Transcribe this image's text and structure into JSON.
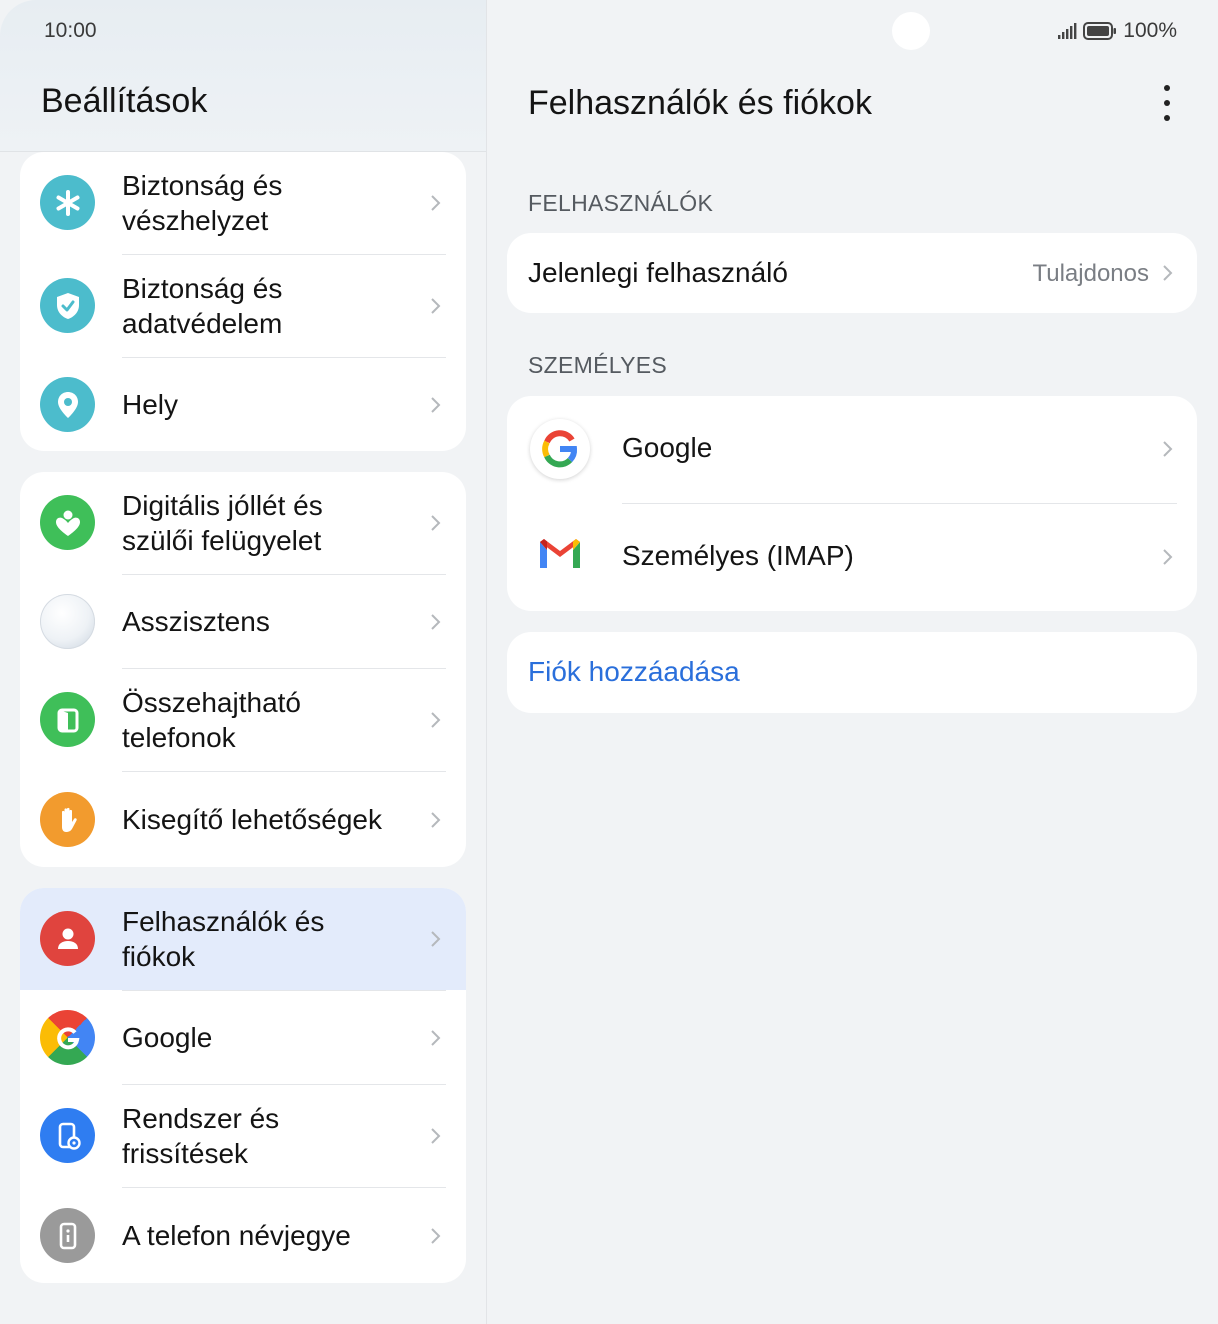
{
  "status_bar": {
    "time": "10:00",
    "battery": "100%"
  },
  "left": {
    "title": "Beállítások",
    "groups": [
      {
        "items": [
          {
            "label_line1": "Biztonság és",
            "label_line2": "vészhelyzet",
            "icon": "emergency-asterisk-icon",
            "color": "#4cbccc"
          },
          {
            "label_line1": "Biztonság és",
            "label_line2": "adatvédelem",
            "icon": "shield-check-icon",
            "color": "#4cbccc"
          },
          {
            "label_line1": "Hely",
            "icon": "location-pin-icon",
            "color": "#4cbccc"
          }
        ]
      },
      {
        "items": [
          {
            "label_line1": "Digitális jóllét és",
            "label_line2": "szülői felügyelet",
            "icon": "heart-person-icon",
            "color": "#3fbf59"
          },
          {
            "label_line1": "Asszisztens",
            "icon": "assistant-orb-icon",
            "color": "#dfe7ee"
          },
          {
            "label_line1": "Összehajtható",
            "label_line2": "telefonok",
            "icon": "foldable-phone-icon",
            "color": "#3fbf59"
          },
          {
            "label_line1": "Kisegítő lehetőségek",
            "icon": "hand-icon",
            "color": "#f29b2e"
          }
        ]
      },
      {
        "items": [
          {
            "label_line1": "Felhasználók és",
            "label_line2": "fiókok",
            "icon": "user-icon",
            "color": "#e0443e",
            "selected": true
          },
          {
            "label_line1": "Google",
            "icon": "google-g-icon"
          },
          {
            "label_line1": "Rendszer és",
            "label_line2": "frissítések",
            "icon": "system-update-icon",
            "color": "#2f7df1"
          },
          {
            "label_line1": "A telefon névjegye",
            "icon": "phone-info-icon",
            "color": "#9a9a9a"
          }
        ]
      }
    ]
  },
  "right": {
    "title": "Felhasználók és fiókok",
    "users_section": "FELHASZNÁLÓK",
    "current_user_label": "Jelenlegi felhasználó",
    "current_user_value": "Tulajdonos",
    "personal_section": "SZEMÉLYES",
    "accounts": [
      {
        "label": "Google",
        "icon": "google-g-icon"
      },
      {
        "label": "Személyes (IMAP)",
        "icon": "gmail-m-icon"
      }
    ],
    "add_account": "Fiók hozzáadása"
  },
  "colors": {
    "accent_link": "#2a6fdb",
    "selected_bg": "#e3ebfb",
    "page_bg": "#f1f3f5"
  }
}
